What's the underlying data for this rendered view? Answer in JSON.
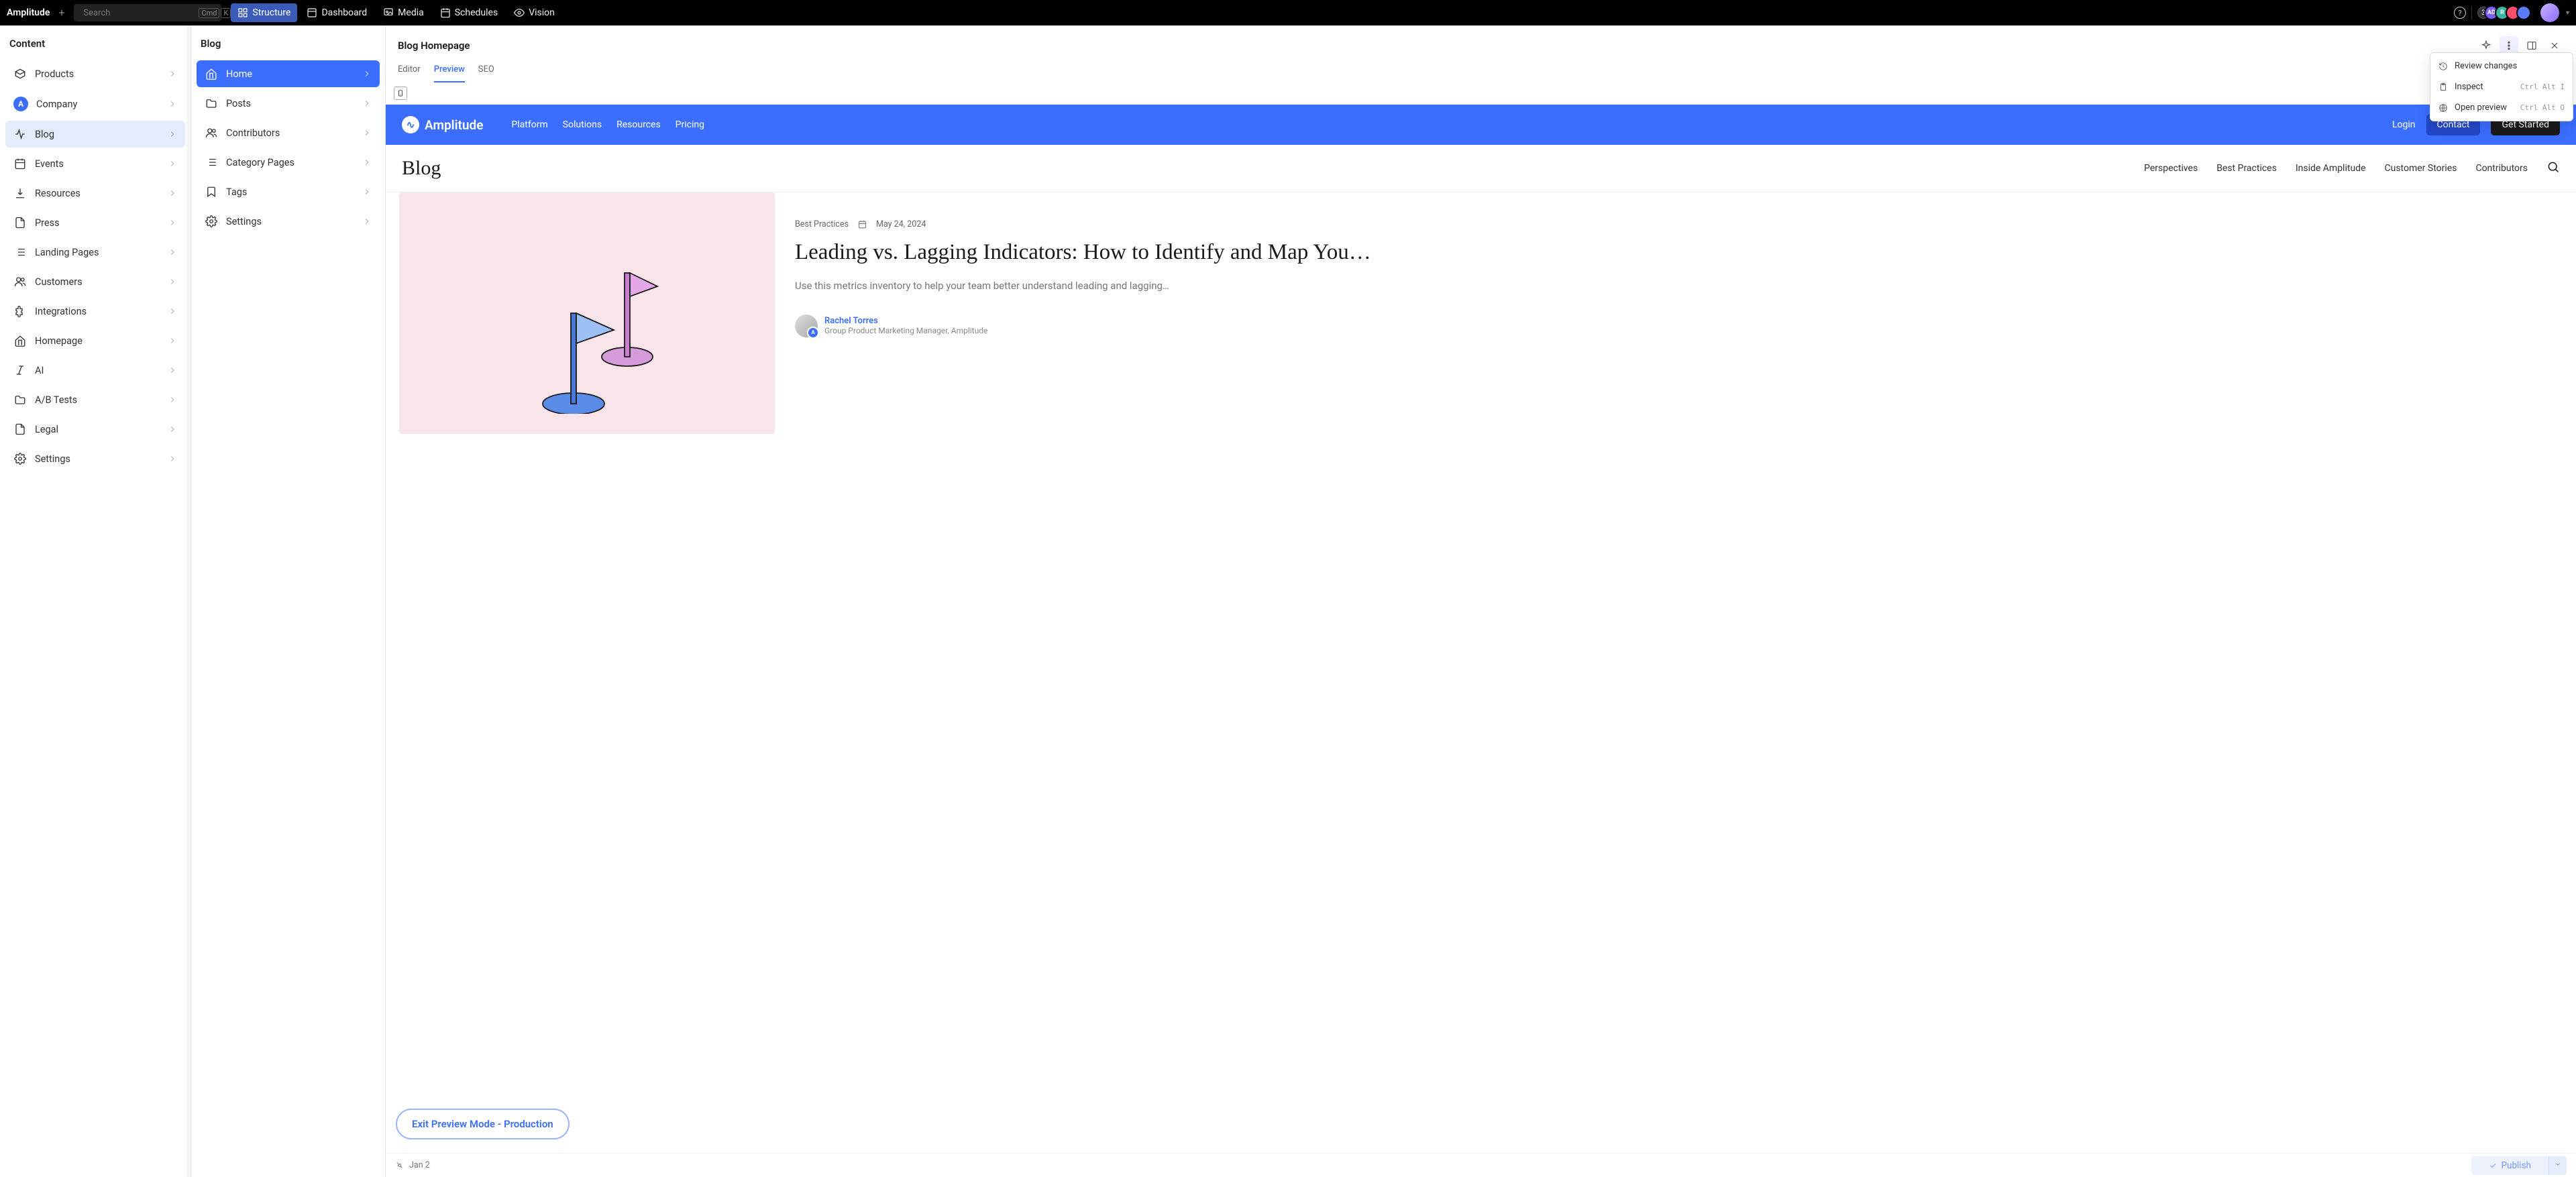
{
  "topbar": {
    "brand": "Amplitude",
    "search_placeholder": "Search",
    "shortcut": {
      "k1": "Cmd",
      "k2": "K"
    },
    "nav": [
      {
        "label": "Structure",
        "active": true
      },
      {
        "label": "Dashboard",
        "active": false
      },
      {
        "label": "Media",
        "active": false
      },
      {
        "label": "Schedules",
        "active": false
      },
      {
        "label": "Vision",
        "active": false
      }
    ],
    "help": "?",
    "avatar_count": "3",
    "avatars": [
      "AD",
      "R",
      "",
      ""
    ]
  },
  "col1": {
    "title": "Content",
    "items": [
      {
        "label": "Products",
        "icon": "box"
      },
      {
        "label": "Company",
        "icon": "company-badge"
      },
      {
        "label": "Blog",
        "icon": "pulse",
        "selected": true
      },
      {
        "label": "Events",
        "icon": "calendar"
      },
      {
        "label": "Resources",
        "icon": "download"
      },
      {
        "label": "Press",
        "icon": "file"
      },
      {
        "label": "Landing Pages",
        "icon": "list"
      },
      {
        "label": "Customers",
        "icon": "users"
      },
      {
        "label": "Integrations",
        "icon": "puzzle"
      },
      {
        "label": "Homepage",
        "icon": "home"
      },
      {
        "label": "AI",
        "icon": "italic"
      },
      {
        "label": "A/B Tests",
        "icon": "folder"
      },
      {
        "label": "Legal",
        "icon": "file"
      },
      {
        "label": "Settings",
        "icon": "gear"
      }
    ]
  },
  "col2": {
    "title": "Blog",
    "items": [
      {
        "label": "Home",
        "icon": "home",
        "active": true
      },
      {
        "label": "Posts",
        "icon": "folder"
      },
      {
        "label": "Contributors",
        "icon": "users"
      },
      {
        "label": "Category Pages",
        "icon": "list"
      },
      {
        "label": "Tags",
        "icon": "bookmark"
      },
      {
        "label": "Settings",
        "icon": "gear"
      }
    ]
  },
  "doc": {
    "title": "Blog Homepage",
    "tabs": [
      {
        "label": "Editor"
      },
      {
        "label": "Preview",
        "active": true
      },
      {
        "label": "SEO"
      }
    ]
  },
  "dropdown": {
    "items": [
      {
        "label": "Review changes",
        "icon": "history"
      },
      {
        "label": "Inspect",
        "icon": "clipboard",
        "kbd": "Ctrl Alt I"
      },
      {
        "label": "Open preview",
        "icon": "globe",
        "kbd": "Ctrl Alt O"
      }
    ]
  },
  "site": {
    "brand": "Amplitude",
    "nav": [
      "Platform",
      "Solutions",
      "Resources",
      "Pricing"
    ],
    "login": "Login",
    "cta1": "Contact",
    "cta2": "Get Started"
  },
  "blog": {
    "title": "Blog",
    "cats": [
      "Perspectives",
      "Best Practices",
      "Inside Amplitude",
      "Customer Stories",
      "Contributors"
    ]
  },
  "hero": {
    "category": "Best Practices",
    "date": "May 24, 2024",
    "title": "Leading vs. Lagging Indicators: How to Identify and Map You…",
    "desc": "Use this metrics inventory to help your team better understand leading and lagging…",
    "author_name": "Rachel Torres",
    "author_role": "Group Product Marketing Manager, Amplitude"
  },
  "exit_preview": "Exit Preview Mode  - Production",
  "footer": {
    "date": "Jan 2",
    "publish": "Publish"
  }
}
